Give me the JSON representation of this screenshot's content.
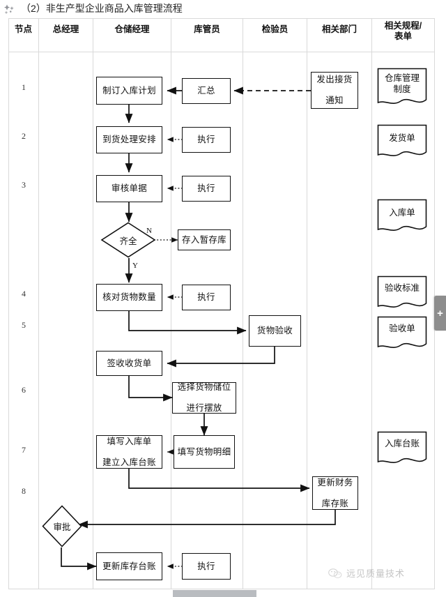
{
  "document": {
    "title": "（2）非生产型企业商品入库管理流程",
    "decoration_icon": "sparkle-icon"
  },
  "table": {
    "columns": [
      {
        "key": "node",
        "label": "节点"
      },
      {
        "key": "gm",
        "label": "总经理"
      },
      {
        "key": "warehouse_manager",
        "label": "仓储经理"
      },
      {
        "key": "keeper",
        "label": "库管员"
      },
      {
        "key": "inspector",
        "label": "检验员"
      },
      {
        "key": "related_dept",
        "label": "相关部门"
      },
      {
        "key": "regulations",
        "label": "相关规程/\n表单",
        "line1": "相关规程/",
        "line2": "表单"
      }
    ],
    "row_numbers": [
      "1",
      "2",
      "3",
      "4",
      "5",
      "6",
      "7",
      "8"
    ]
  },
  "flowchart": {
    "type": "swimlane-flowchart",
    "nodes": [
      {
        "id": "n1",
        "label": "制订入库计划",
        "shape": "process",
        "lane": "仓储经理",
        "row": "1"
      },
      {
        "id": "n2",
        "label": "汇总",
        "shape": "process",
        "lane": "库管员",
        "row": "1"
      },
      {
        "id": "n3",
        "label": "发出接货\n通知",
        "shape": "process",
        "lane": "相关部门",
        "row": "1",
        "line1": "发出接货",
        "line2": "通知"
      },
      {
        "id": "d1",
        "label": "仓库管理\n制度",
        "shape": "document",
        "lane": "相关规程/表单",
        "row": "1",
        "line1": "仓库管理",
        "line2": "制度"
      },
      {
        "id": "n4",
        "label": "到货处理安排",
        "shape": "process",
        "lane": "仓储经理",
        "row": "2"
      },
      {
        "id": "n5",
        "label": "执行",
        "shape": "process",
        "lane": "库管员",
        "row": "2"
      },
      {
        "id": "d2",
        "label": "发货单",
        "shape": "document",
        "lane": "相关规程/表单",
        "row": "2"
      },
      {
        "id": "n6",
        "label": "审核单据",
        "shape": "process",
        "lane": "仓储经理",
        "row": "3"
      },
      {
        "id": "n7",
        "label": "执行",
        "shape": "process",
        "lane": "库管员",
        "row": "3"
      },
      {
        "id": "d3",
        "label": "入库单",
        "shape": "document",
        "lane": "相关规程/表单",
        "row": "3"
      },
      {
        "id": "dec1",
        "label": "齐全",
        "shape": "decision",
        "lane": "仓储经理",
        "row": "3"
      },
      {
        "id": "n8",
        "label": "存入暂存库",
        "shape": "process",
        "lane": "库管员",
        "row": "3"
      },
      {
        "id": "n9",
        "label": "核对货物数量",
        "shape": "process",
        "lane": "仓储经理",
        "row": "4"
      },
      {
        "id": "n10",
        "label": "执行",
        "shape": "process",
        "lane": "库管员",
        "row": "4"
      },
      {
        "id": "d4",
        "label": "验收标准",
        "shape": "document",
        "lane": "相关规程/表单",
        "row": "4"
      },
      {
        "id": "n11",
        "label": "货物验收",
        "shape": "process",
        "lane": "检验员",
        "row": "5"
      },
      {
        "id": "d5",
        "label": "验收单",
        "shape": "document",
        "lane": "相关规程/表单",
        "row": "5"
      },
      {
        "id": "n12",
        "label": "签收收货单",
        "shape": "process",
        "lane": "仓储经理",
        "row": "5"
      },
      {
        "id": "n13",
        "label": "选择货物储位\n进行摆放",
        "shape": "process",
        "lane": "库管员",
        "row": "6",
        "line1": "选择货物储位",
        "line2": "进行摆放"
      },
      {
        "id": "n14",
        "label": "填写入库单\n建立入库台账",
        "shape": "process",
        "lane": "仓储经理",
        "row": "7",
        "line1": "填写入库单",
        "line2": "建立入库台账"
      },
      {
        "id": "n15",
        "label": "填写货物明细",
        "shape": "process",
        "lane": "库管员",
        "row": "7"
      },
      {
        "id": "d6",
        "label": "入库台账",
        "shape": "document",
        "lane": "相关规程/表单",
        "row": "7"
      },
      {
        "id": "n16",
        "label": "更新财务\n库存账",
        "shape": "process",
        "lane": "相关部门",
        "row": "8",
        "line1": "更新财务",
        "line2": "库存账"
      },
      {
        "id": "dec2",
        "label": "审批",
        "shape": "decision",
        "lane": "总经理",
        "row": "8"
      },
      {
        "id": "n17",
        "label": "更新库存台账",
        "shape": "process",
        "lane": "仓储经理",
        "row": "8"
      },
      {
        "id": "n18",
        "label": "执行",
        "shape": "process",
        "lane": "库管员",
        "row": "8"
      }
    ],
    "edge_labels": [
      {
        "id": "lblN",
        "text": "N",
        "from": "dec1",
        "to": "n8"
      },
      {
        "id": "lblY",
        "text": "Y",
        "from": "dec1",
        "to": "n9"
      }
    ]
  },
  "widgets": {
    "plus_tab": {
      "icon": "plus-icon",
      "label": "+"
    }
  },
  "watermark": {
    "text": "远见质量技术",
    "icon": "wechat-logo-icon"
  },
  "colors": {
    "stroke": "#111111",
    "grid": "#d8d8d8",
    "tab_gray": "#8d8d8d",
    "watermark_gray": "#9a9a9a"
  }
}
